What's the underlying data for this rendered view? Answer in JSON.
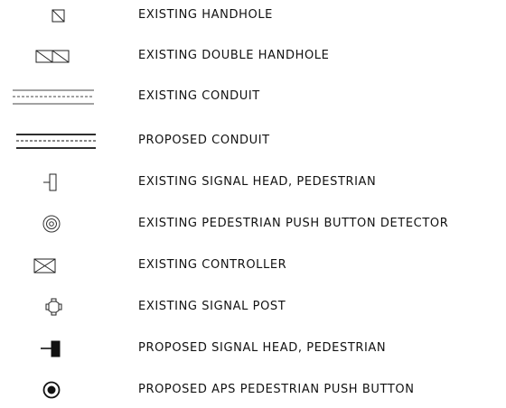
{
  "legend": {
    "items": [
      {
        "icon": "existing-handhole-icon",
        "label": "EXISTING HANDHOLE"
      },
      {
        "icon": "existing-double-handhole-icon",
        "label": "EXISTING DOUBLE HANDHOLE"
      },
      {
        "icon": "existing-conduit-icon",
        "label": "EXISTING CONDUIT"
      },
      {
        "icon": "proposed-conduit-icon",
        "label": "PROPOSED CONDUIT"
      },
      {
        "icon": "existing-pedestrian-signal-head-icon",
        "label": "EXISTING SIGNAL HEAD, PEDESTRIAN"
      },
      {
        "icon": "existing-push-button-detector-icon",
        "label": "EXISTING PEDESTRIAN PUSH BUTTON DETECTOR"
      },
      {
        "icon": "existing-controller-icon",
        "label": "EXISTING CONTROLLER"
      },
      {
        "icon": "existing-signal-post-icon",
        "label": "EXISTING SIGNAL POST"
      },
      {
        "icon": "proposed-pedestrian-signal-head-icon",
        "label": "PROPOSED SIGNAL HEAD, PEDESTRIAN"
      },
      {
        "icon": "proposed-aps-push-button-icon",
        "label": "PROPOSED APS PEDESTRIAN PUSH BUTTON"
      }
    ]
  },
  "colors": {
    "line": "#222222",
    "text": "#111111",
    "background": "#ffffff"
  }
}
